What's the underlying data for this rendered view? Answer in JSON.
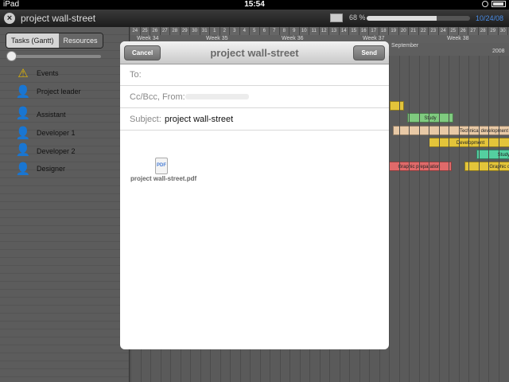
{
  "status": {
    "carrier": "iPad",
    "time": "15:54"
  },
  "app": {
    "title": "project wall-street",
    "progress_text": "68 %",
    "progress_value": 0.68,
    "date": "10/24/08"
  },
  "left": {
    "segments": [
      "Tasks (Gantt)",
      "Resources"
    ],
    "resources": [
      {
        "label": "Events",
        "icon": "warning-icon"
      },
      {
        "label": "Project leader",
        "icon": "person-icon"
      },
      {
        "label": "Assistant",
        "icon": "person-icon"
      },
      {
        "label": "Developer 1",
        "icon": "person-icon"
      },
      {
        "label": "Developer 2",
        "icon": "person-icon"
      },
      {
        "label": "Designer",
        "icon": "person-icon"
      }
    ]
  },
  "gantt": {
    "days": [
      "24",
      "25",
      "26",
      "27",
      "28",
      "29",
      "30",
      "31",
      "1",
      "2",
      "3",
      "4",
      "5",
      "6",
      "7",
      "8",
      "9",
      "10",
      "11",
      "12",
      "13",
      "14",
      "15",
      "16",
      "17",
      "18",
      "19",
      "20",
      "21",
      "22",
      "23",
      "24",
      "25",
      "26",
      "27",
      "28",
      "29",
      "30"
    ],
    "weeks": [
      "Week 34",
      "Week 35",
      "Week 36",
      "Week 37",
      "Week 38"
    ],
    "month": "September",
    "year": "2008",
    "bars": [
      {
        "label": "",
        "color": "#e3c43a"
      },
      {
        "label": "Study",
        "color": "#7fcb7f"
      },
      {
        "label": "Technical development",
        "color": "#e8c9a6"
      },
      {
        "label": "Development",
        "color": "#e3c43a"
      },
      {
        "label": "Study",
        "color": "#54cfa0"
      },
      {
        "label": "Graphic preparation",
        "color": "#e06a6a"
      },
      {
        "label": "Graphic c",
        "color": "#e3c43a"
      }
    ]
  },
  "modal": {
    "title": "project wall-street",
    "cancel": "Cancel",
    "send": "Send",
    "to_label": "To:",
    "cc_label": "Cc/Bcc, From:",
    "subject_label": "Subject:",
    "subject_value": "project wall-street",
    "attachment_icon_text": "PDF",
    "attachment_name": "project wall-street.pdf"
  }
}
